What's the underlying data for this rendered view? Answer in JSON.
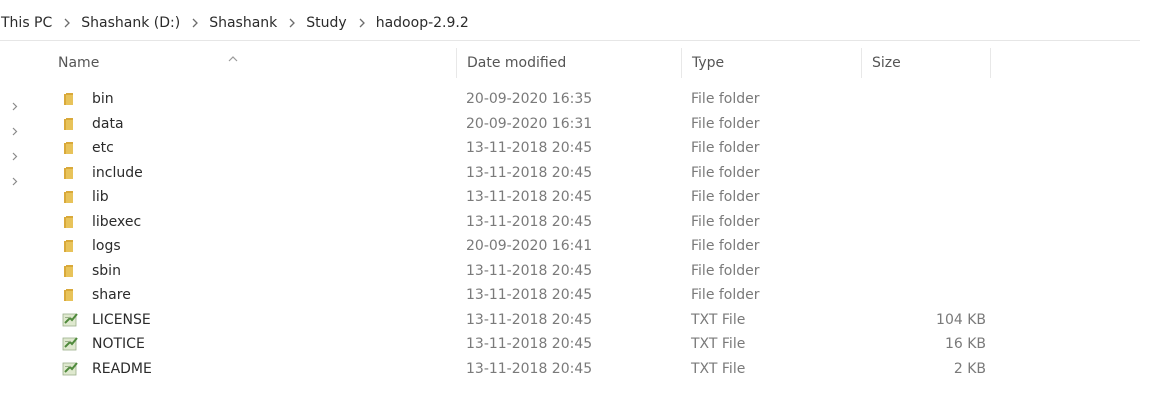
{
  "breadcrumb": {
    "items": [
      {
        "label": "This PC"
      },
      {
        "label": "Shashank (D:)"
      },
      {
        "label": "Study"
      },
      {
        "label": "hadoop-2.9.2"
      }
    ],
    "items_full": [
      "This PC",
      "Shashank (D:)",
      "Shashank",
      "Study",
      "hadoop-2.9.2"
    ]
  },
  "crumbs": {
    "c0": "This PC",
    "c1": "Shashank (D:)",
    "c2": "Shashank",
    "c3": "Study",
    "c4": "hadoop-2.9.2"
  },
  "header": {
    "name": "Name",
    "date_modified": "Date modified",
    "type": "Type",
    "size": "Size"
  },
  "files": [
    {
      "name": "bin",
      "date": "20-09-2020 16:35",
      "type": "File folder",
      "size": "",
      "icon": "folder-icon"
    },
    {
      "name": "data",
      "date": "20-09-2020 16:31",
      "type": "File folder",
      "size": "",
      "icon": "folder-icon"
    },
    {
      "name": "etc",
      "date": "13-11-2018 20:45",
      "type": "File folder",
      "size": "",
      "icon": "folder-icon"
    },
    {
      "name": "include",
      "date": "13-11-2018 20:45",
      "type": "File folder",
      "size": "",
      "icon": "folder-icon"
    },
    {
      "name": "lib",
      "date": "13-11-2018 20:45",
      "type": "File folder",
      "size": "",
      "icon": "folder-icon"
    },
    {
      "name": "libexec",
      "date": "13-11-2018 20:45",
      "type": "File folder",
      "size": "",
      "icon": "folder-icon"
    },
    {
      "name": "logs",
      "date": "20-09-2020 16:41",
      "type": "File folder",
      "size": "",
      "icon": "folder-icon"
    },
    {
      "name": "sbin",
      "date": "13-11-2018 20:45",
      "type": "File folder",
      "size": "",
      "icon": "folder-icon"
    },
    {
      "name": "share",
      "date": "13-11-2018 20:45",
      "type": "File folder",
      "size": "",
      "icon": "folder-icon"
    },
    {
      "name": "LICENSE",
      "date": "13-11-2018 20:45",
      "type": "TXT File",
      "size": "104 KB",
      "icon": "text-file-icon"
    },
    {
      "name": "NOTICE",
      "date": "13-11-2018 20:45",
      "type": "TXT File",
      "size": "16 KB",
      "icon": "text-file-icon"
    },
    {
      "name": "README",
      "date": "13-11-2018 20:45",
      "type": "TXT File",
      "size": "2 KB",
      "icon": "text-file-icon"
    }
  ],
  "colors": {
    "folder": "#e8c35a",
    "folder_dark": "#d9a93a",
    "text_file_body": "#dfe9cf",
    "text_file_accent": "#4f8a3c",
    "nav_arrow": "#8a8a8a"
  },
  "icons": {
    "breadcrumb_separator": "chevron-right-icon",
    "sort": "sort-ascending-icon",
    "nav_expand": "chevron-right-small-icon"
  }
}
